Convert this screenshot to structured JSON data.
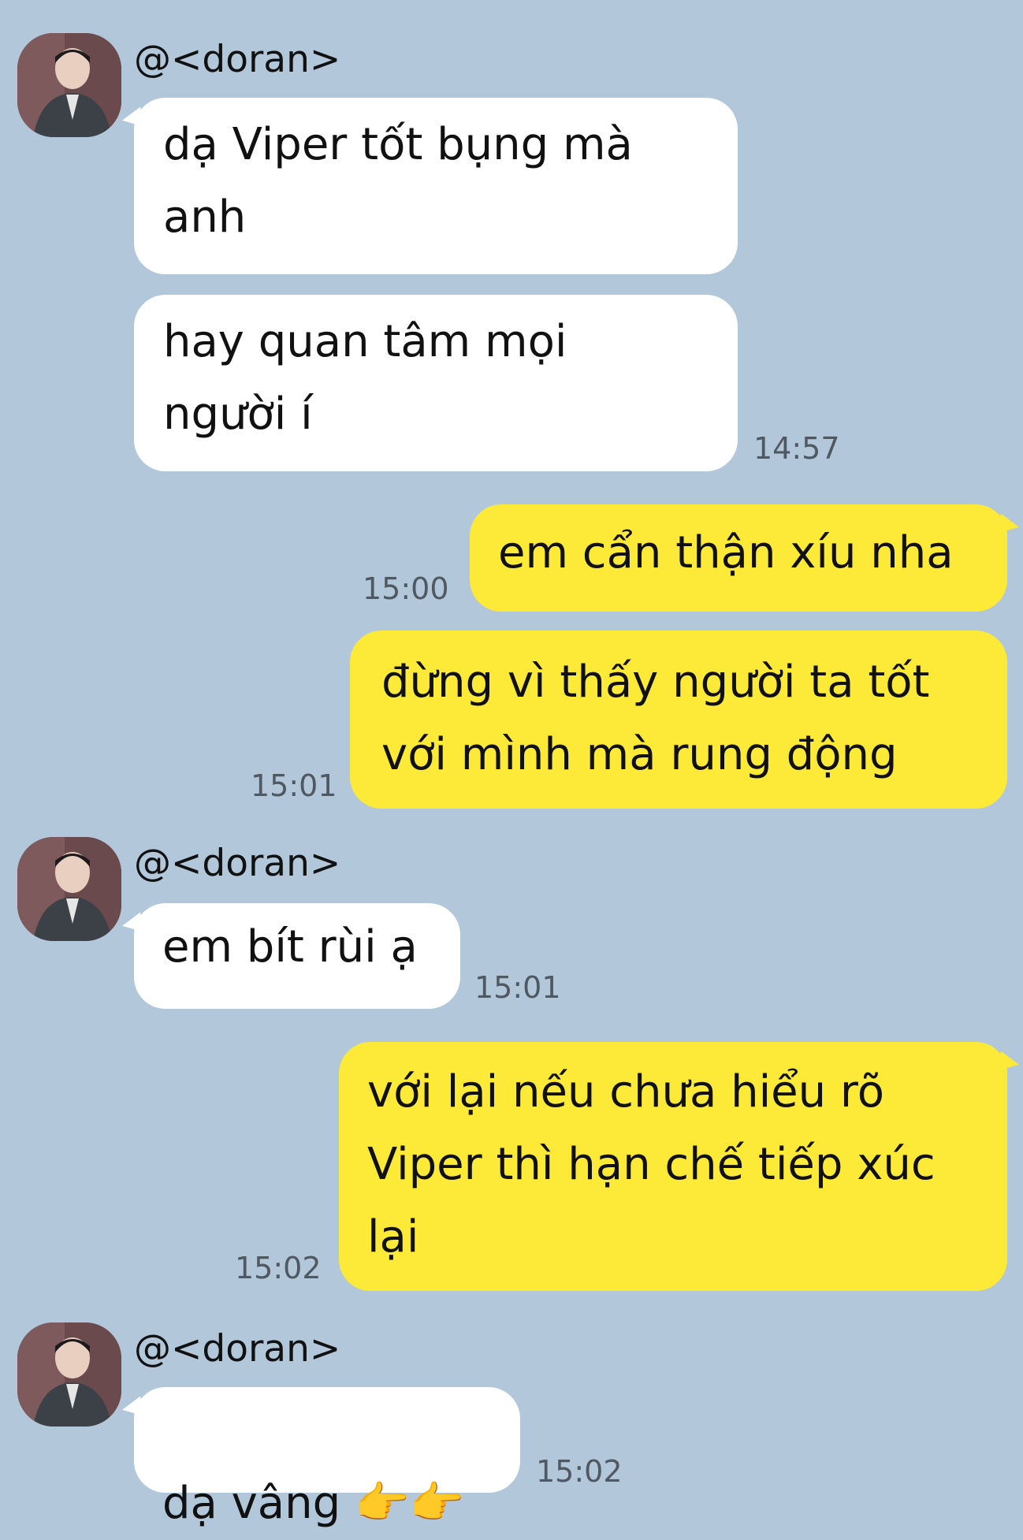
{
  "messages": [
    {
      "sender": "@<doran>",
      "bubbles": [
        {
          "text": "dạ Viper tốt bụng mà\nanh"
        },
        {
          "text": "hay quan tâm mọi\nngười í",
          "time": "14:57"
        }
      ]
    },
    {
      "sender": "me",
      "bubbles": [
        {
          "text": "em cẩn thận xíu nha",
          "time": "15:00"
        },
        {
          "text": "đừng vì thấy người ta tốt\nvới mình mà rung động",
          "time": "15:01"
        }
      ]
    },
    {
      "sender": "@<doran>",
      "bubbles": [
        {
          "text": "em bít rùi ạ",
          "time": "15:01"
        }
      ]
    },
    {
      "sender": "me",
      "bubbles": [
        {
          "text": "với lại nếu chưa hiểu rõ\nViper thì hạn chế tiếp xúc\nlại",
          "time": "15:02"
        }
      ]
    },
    {
      "sender": "@<doran>",
      "bubbles": [
        {
          "text": "dạ vâng ",
          "emoji": "👉👉",
          "time": "15:02"
        }
      ]
    }
  ],
  "colors": {
    "background": "#b2c7da",
    "incoming_bubble": "#ffffff",
    "outgoing_bubble": "#fde937",
    "time_text": "#505862"
  },
  "icons": {
    "avatar": "profile-photo",
    "emoji": "pointing-hands-emoji"
  }
}
